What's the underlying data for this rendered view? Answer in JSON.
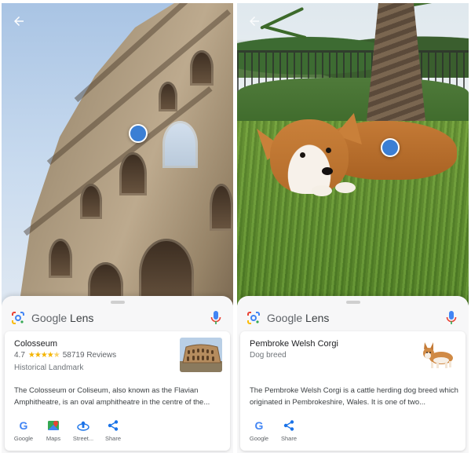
{
  "screens": [
    {
      "lens": {
        "brand_google": "Google",
        "brand_lens": "Lens"
      },
      "result": {
        "title": "Colosseum",
        "rating": "4.7",
        "stars_value": 4.7,
        "reviews": "58719 Reviews",
        "category": "Historical Landmark",
        "description": "The Colosseum or Coliseum, also known as the Flavian Amphitheatre, is an oval amphitheatre in the centre of the..."
      },
      "actions": [
        {
          "label": "Google",
          "icon": "google-icon"
        },
        {
          "label": "Maps",
          "icon": "maps-icon"
        },
        {
          "label": "Street...",
          "icon": "street-view-icon"
        },
        {
          "label": "Share",
          "icon": "share-icon"
        }
      ]
    },
    {
      "lens": {
        "brand_google": "Google",
        "brand_lens": "Lens"
      },
      "result": {
        "title": "Pembroke Welsh Corgi",
        "category": "Dog breed",
        "description": "The Pembroke Welsh Corgi is a cattle herding dog breed which originated in Pembrokeshire, Wales. It is one of two..."
      },
      "actions": [
        {
          "label": "Google",
          "icon": "google-icon"
        },
        {
          "label": "Share",
          "icon": "share-icon"
        }
      ]
    }
  ],
  "colors": {
    "accent_blue": "#3b7fd4",
    "star": "#f4b400",
    "sheet_bg": "#f7f7f8"
  }
}
